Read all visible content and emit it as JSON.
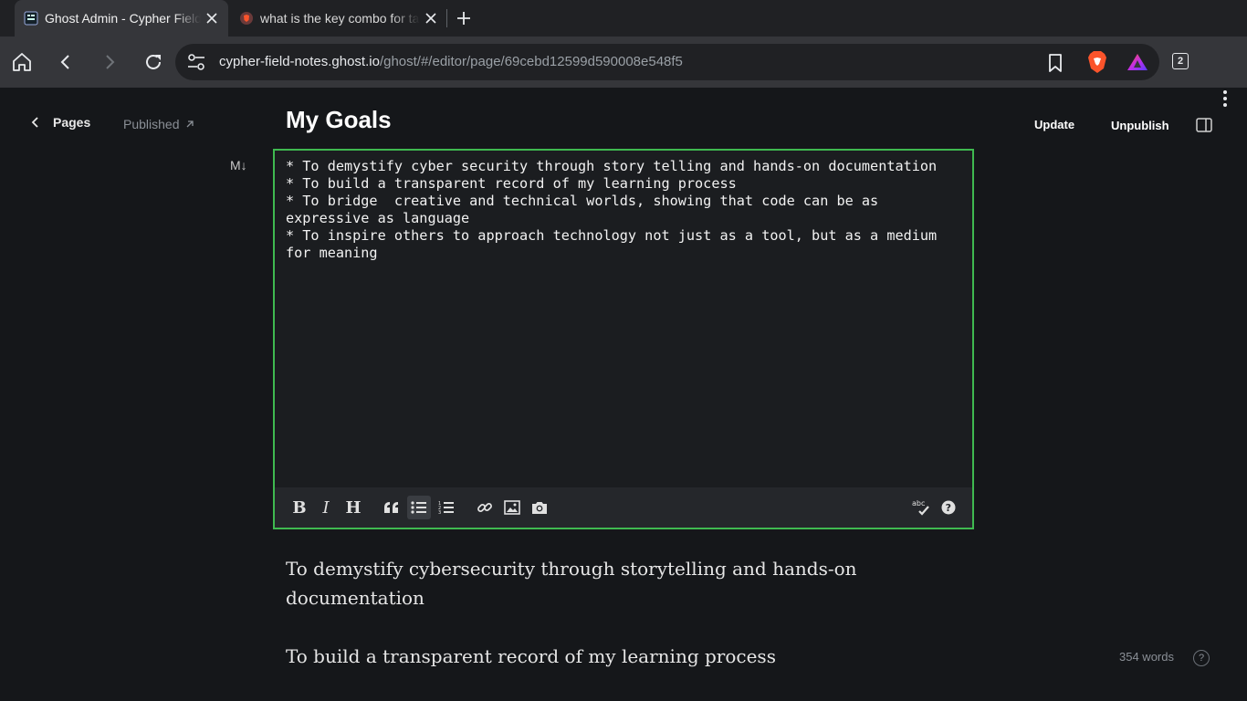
{
  "browser": {
    "tabs": [
      {
        "title": "Ghost Admin - Cypher Field Notes",
        "active": true,
        "icon": "ghost-favicon"
      },
      {
        "title": "what is the key combo for tab",
        "active": false,
        "icon": "brave-favicon"
      }
    ],
    "address": {
      "host": "cypher-field-notes.ghost.io",
      "path": "/ghost/#/editor/page/69cebd12599d590008e548f5"
    },
    "tab_count": "2"
  },
  "header": {
    "back_label": "Pages",
    "status_label": "Published",
    "update_label": "Update",
    "unpublish_label": "Unpublish"
  },
  "page": {
    "title": "My Goals"
  },
  "editor": {
    "mode_indicator": "M↓",
    "markdown": "* To demystify cyber security through story telling and hands-on documentation\n* To build a transparent record of my learning process\n* To bridge  creative and technical worlds, showing that code can be as expressive as language\n* To inspire others to approach technology not just as a tool, but as a medium for meaning",
    "toolbar": [
      "bold",
      "italic",
      "heading",
      "quote",
      "unordered-list",
      "ordered-list",
      "link",
      "image",
      "unsplash",
      "spellcheck",
      "help"
    ],
    "spellcheck_label": "abc"
  },
  "rendered": {
    "paragraphs": [
      "To demystify cybersecurity through storytelling and hands-on documentation",
      "To build a transparent record of my learning process"
    ]
  },
  "footer": {
    "word_count": "354 words",
    "help_label": "?"
  },
  "colors": {
    "editor_border": "#3fb950",
    "background": "#15171a",
    "brave_orange": "#fb542b"
  }
}
